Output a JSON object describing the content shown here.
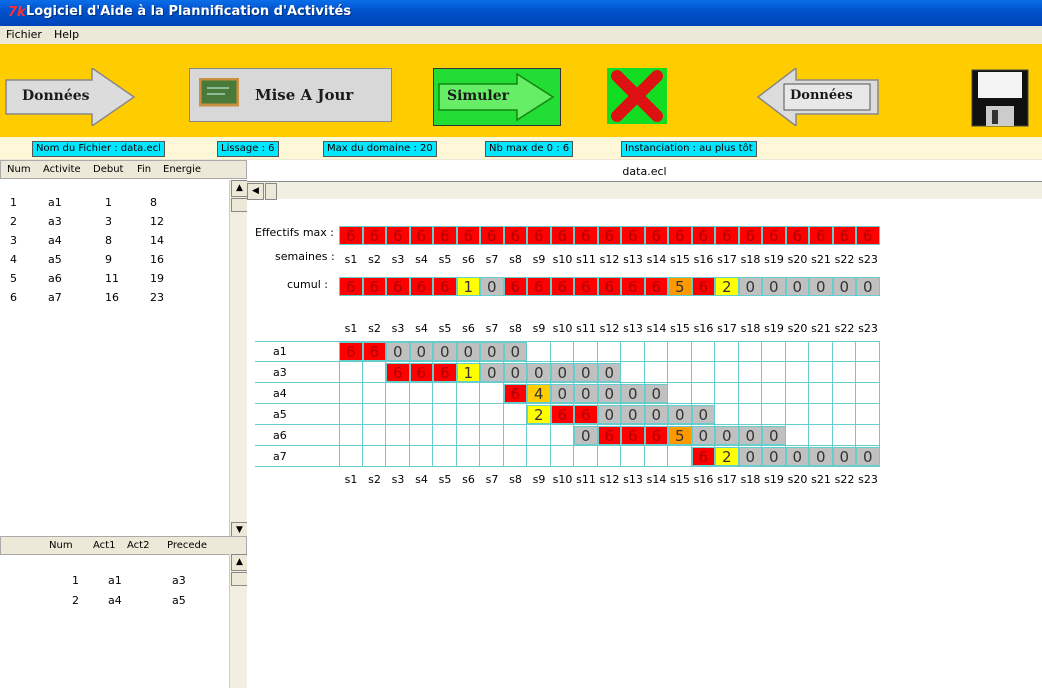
{
  "window": {
    "title": "Logiciel d'Aide à la Plannification d'Activités",
    "icon": "7k"
  },
  "menu": [
    "Fichier",
    "Help"
  ],
  "toolbar": {
    "donnees_left": "Données",
    "mise_a_jour": "Mise A Jour",
    "simuler": "Simuler",
    "donnees_right": "Données"
  },
  "info": {
    "fichier": "Nom du Fichier : data.ecl",
    "lissage": "Lissage : 6",
    "max_domaine": "Max du domaine : 20",
    "nb_max": "Nb max de 0 : 6",
    "instanciation": "Instanciation : au plus tôt"
  },
  "activities_table": {
    "headers": [
      "Num",
      "Activite",
      "Debut",
      "Fin",
      "Energie"
    ],
    "rows": [
      [
        "1",
        "a1",
        "1",
        "8"
      ],
      [
        "2",
        "a3",
        "3",
        "12"
      ],
      [
        "3",
        "a4",
        "8",
        "14"
      ],
      [
        "4",
        "a5",
        "9",
        "16"
      ],
      [
        "5",
        "a6",
        "11",
        "19"
      ],
      [
        "6",
        "a7",
        "16",
        "23"
      ]
    ]
  },
  "precedence_table": {
    "headers": [
      "Num",
      "Act1",
      "Act2",
      "Precede"
    ],
    "rows": [
      [
        "1",
        "a1",
        "a3"
      ],
      [
        "2",
        "a4",
        "a5"
      ]
    ]
  },
  "chart": {
    "file_title": "data.ecl",
    "effectifs_label": "Effectifs max :",
    "semaines_label": "semaines :",
    "cumul_label": "cumul :",
    "weeks": [
      "s1",
      "s2",
      "s3",
      "s4",
      "s5",
      "s6",
      "s7",
      "s8",
      "s9",
      "s10",
      "s11",
      "s12",
      "s13",
      "s14",
      "s15",
      "s16",
      "s17",
      "s18",
      "s19",
      "s20",
      "s21",
      "s22",
      "s23"
    ],
    "effectifs": [
      "6",
      "6",
      "6",
      "6",
      "6",
      "6",
      "6",
      "6",
      "6",
      "6",
      "6",
      "6",
      "6",
      "6",
      "6",
      "6",
      "6",
      "6",
      "6",
      "6",
      "6",
      "6",
      "6"
    ],
    "cumul": [
      "6",
      "6",
      "6",
      "6",
      "6",
      "1",
      "0",
      "6",
      "6",
      "6",
      "6",
      "6",
      "6",
      "6",
      "5",
      "6",
      "2",
      "0",
      "0",
      "0",
      "0",
      "0",
      "0"
    ],
    "activities": [
      {
        "name": "a1",
        "start": 1,
        "values": [
          "6",
          "6",
          "0",
          "0",
          "0",
          "0",
          "0",
          "0"
        ]
      },
      {
        "name": "a3",
        "start": 3,
        "values": [
          "6",
          "6",
          "6",
          "1",
          "0",
          "0",
          "0",
          "0",
          "0",
          "0"
        ]
      },
      {
        "name": "a4",
        "start": 8,
        "values": [
          "6",
          "4",
          "0",
          "0",
          "0",
          "0",
          "0"
        ]
      },
      {
        "name": "a5",
        "start": 9,
        "values": [
          "2",
          "6",
          "6",
          "0",
          "0",
          "0",
          "0",
          "0"
        ]
      },
      {
        "name": "a6",
        "start": 11,
        "values": [
          "0",
          "6",
          "6",
          "6",
          "5",
          "0",
          "0",
          "0",
          "0"
        ]
      },
      {
        "name": "a7",
        "start": 16,
        "values": [
          "6",
          "2",
          "0",
          "0",
          "0",
          "0",
          "0",
          "0"
        ]
      }
    ],
    "colors": {
      "6": "#ff0000",
      "5": "#ff9900",
      "4": "#ffcc00",
      "2": "#ffff00",
      "1": "#ffff00",
      "0": "#c0c0c0"
    }
  }
}
